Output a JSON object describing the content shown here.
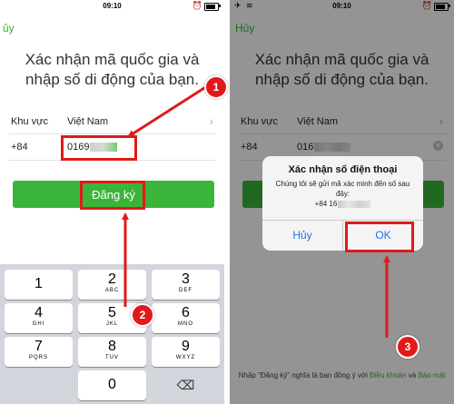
{
  "status_bar": {
    "time": "09:10",
    "alarm_icon": "alarm-icon",
    "battery_icon": "battery-icon"
  },
  "left_screen": {
    "cancel_label": "ủy",
    "heading": "Xác nhận mã quốc gia và nhập số di động của bạn.",
    "region_label": "Khu vực",
    "region_value": "Việt Nam",
    "country_code": "+84",
    "phone_prefix": "0169",
    "register_label": "Đăng ký",
    "keypad": [
      {
        "digit": "1",
        "letters": ""
      },
      {
        "digit": "2",
        "letters": "ABC"
      },
      {
        "digit": "3",
        "letters": "DEF"
      },
      {
        "digit": "4",
        "letters": "GHI"
      },
      {
        "digit": "5",
        "letters": "JKL"
      },
      {
        "digit": "6",
        "letters": "MNO"
      },
      {
        "digit": "7",
        "letters": "PQRS"
      },
      {
        "digit": "8",
        "letters": "TUV"
      },
      {
        "digit": "9",
        "letters": "WXYZ"
      },
      {
        "digit": "",
        "letters": ""
      },
      {
        "digit": "0",
        "letters": ""
      },
      {
        "digit": "⌫",
        "letters": ""
      }
    ]
  },
  "right_screen": {
    "cancel_label": "Hủy",
    "heading": "Xác nhận mã quốc gia và nhập số di động của bạn.",
    "region_label": "Khu vực",
    "region_value": "Việt Nam",
    "country_code": "+84",
    "phone_prefix": "016",
    "dialog": {
      "title": "Xác nhận số điện thoại",
      "message": "Chúng tôi sẽ gửi mã xác minh đến số sau đây:",
      "number": "+84 16",
      "cancel": "Hủy",
      "ok": "OK"
    },
    "footer_prefix": "Nhấp \"Đăng ký\" nghĩa là bạn đồng ý với ",
    "footer_link1": "Điều khoản",
    "footer_mid": " và ",
    "footer_link2": "Bảo mật"
  },
  "callouts": [
    "1",
    "2",
    "3"
  ],
  "colors": {
    "accent_green": "#3ab53a",
    "link_green": "#2eb82e",
    "callout_red": "#e01a1a",
    "ok_blue": "#1a73e8"
  }
}
